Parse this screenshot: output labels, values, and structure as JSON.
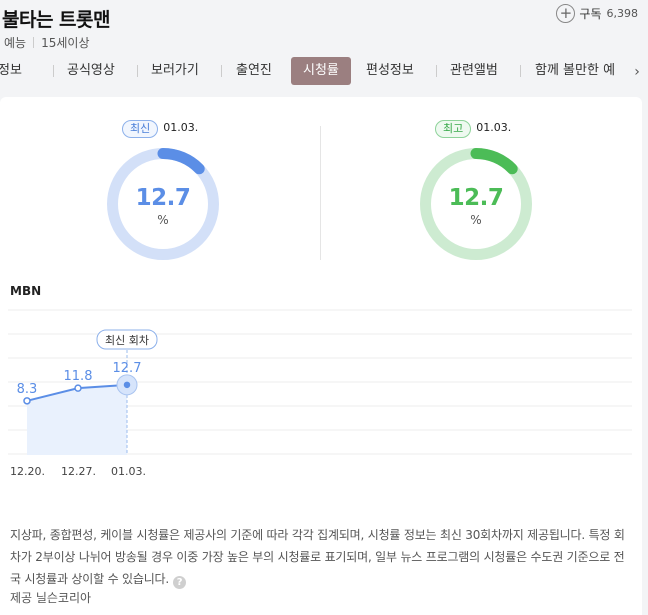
{
  "header": {
    "title": "불타는 트롯맨",
    "genre": "예능",
    "rating": "15세이상",
    "subscribe_label": "구독",
    "subscribe_count": "6,398"
  },
  "tabs": [
    {
      "label": "정보"
    },
    {
      "label": "공식영상"
    },
    {
      "label": "보러가기"
    },
    {
      "label": "출연진"
    },
    {
      "label": "시청률",
      "active": true
    },
    {
      "label": "편성정보"
    },
    {
      "label": "관련앨범"
    },
    {
      "label": "함께 볼만한 예"
    }
  ],
  "gauges": {
    "latest": {
      "badge": "최신",
      "date": "01.03.",
      "value": "12.7",
      "unit": "%",
      "color": "#5b8ee6",
      "track": "#d3e0f8",
      "fraction": 0.127
    },
    "highest": {
      "badge": "최고",
      "date": "01.03.",
      "value": "12.7",
      "unit": "%",
      "color": "#4cbc57",
      "track": "#cdebd1",
      "fraction": 0.127
    }
  },
  "channel": "MBN",
  "chart_data": {
    "type": "line",
    "categories": [
      "12.20.",
      "12.27.",
      "01.03."
    ],
    "values": [
      8.3,
      11.8,
      12.7
    ],
    "data_labels": [
      "8.3",
      "11.8",
      "12.7"
    ],
    "annotation": "최신 회차",
    "ylim": [
      0,
      20
    ],
    "grid": true,
    "color": "#5b8ee6"
  },
  "notice": {
    "text": "지상파, 종합편성, 케이블 시청률은 제공사의 기준에 따라 각각 집계되며, 시청률 정보는 최신 30회차까지 제공됩니다. 특정 회차가 2부이상 나뉘어 방송될 경우 이중 가장 높은 부의 시청률로 표기되며, 일부 뉴스 프로그램의 시청률은 수도권 기준으로 전국 시청률과 상이할 수 있습니다.",
    "help_icon": "question-icon",
    "provider": "제공 닐슨코리아"
  }
}
